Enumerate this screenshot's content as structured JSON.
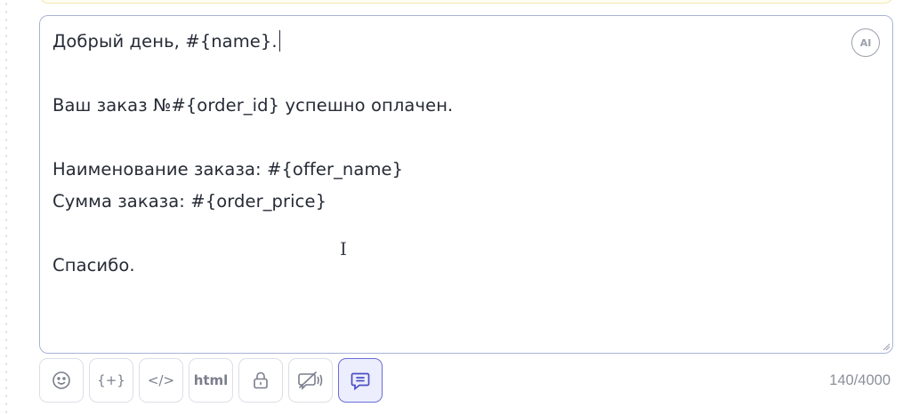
{
  "editor": {
    "lines": [
      "Добрый день, #{name}.",
      "",
      "Ваш заказ №#{order_id} успешно оплачен.",
      "",
      "Наименование заказа: #{offer_name}",
      "Сумма заказа: #{order_price}",
      "",
      "Спасибо."
    ],
    "ai_label": "AI"
  },
  "toolbar": {
    "buttons": [
      {
        "icon": "smile-icon"
      },
      {
        "label": "{+}",
        "icon": "variable-insert-icon"
      },
      {
        "label": "</>",
        "icon": "code-icon"
      },
      {
        "label": "html",
        "icon": "html-icon"
      },
      {
        "icon": "lock-icon"
      },
      {
        "icon": "speech-off-icon"
      },
      {
        "icon": "message-icon",
        "active": true
      }
    ]
  },
  "counter": "140/4000",
  "colors": {
    "accent": "#6b6dd8",
    "editor_border": "#a9b3d6",
    "text": "#262b36",
    "muted": "#8c909b"
  }
}
